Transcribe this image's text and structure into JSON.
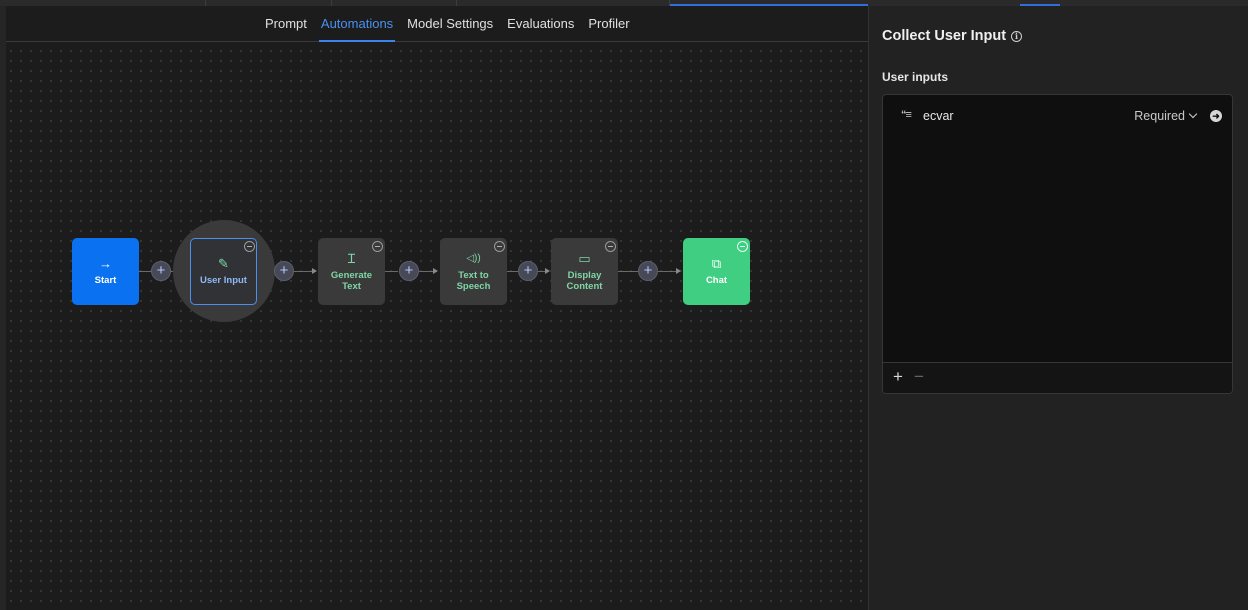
{
  "tabs": [
    {
      "label": "Prompt",
      "active": false
    },
    {
      "label": "Automations",
      "active": true
    },
    {
      "label": "Model Settings",
      "active": false
    },
    {
      "label": "Evaluations",
      "active": false
    },
    {
      "label": "Profiler",
      "active": false
    }
  ],
  "flow": {
    "nodes": [
      {
        "id": "start",
        "label": "Start",
        "icon": "→",
        "icon_name": "arrow-right-icon"
      },
      {
        "id": "user_input",
        "label": "User Input",
        "icon": "✎",
        "icon_name": "edit-icon",
        "selected": true
      },
      {
        "id": "generate_text",
        "label": "Generate Text",
        "icon": "Ɪ",
        "icon_name": "text-cursor-icon"
      },
      {
        "id": "tts",
        "label": "Text to Speech",
        "icon": "◁))",
        "icon_name": "speaker-icon"
      },
      {
        "id": "display",
        "label": "Display Content",
        "icon": "▭",
        "icon_name": "message-square-icon"
      },
      {
        "id": "chat",
        "label": "Chat",
        "icon": "⧉",
        "icon_name": "chat-bubbles-icon"
      }
    ],
    "add_symbol": "+"
  },
  "panel": {
    "title": "Collect User Input",
    "info_symbol": "i",
    "subtitle": "User inputs",
    "inputs": [
      {
        "icon": "“≡",
        "icon_name": "variable-icon",
        "name": "ecvar",
        "requirement": "Required"
      }
    ],
    "add_symbol": "+",
    "remove_symbol": "−"
  },
  "colors": {
    "accent": "#3d82ee",
    "start": "#0a72f0",
    "chat": "#3fce82",
    "node_dark": "#3a3a3a",
    "node_text": "#7fd6a6"
  }
}
